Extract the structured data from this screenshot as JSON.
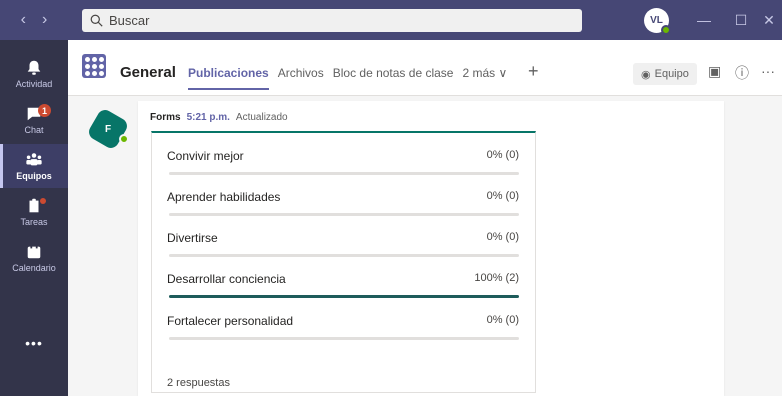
{
  "app": {
    "search_placeholder": "Buscar",
    "user_initials": "VL",
    "accent": "#6264a7",
    "titlebar_color": "#464775"
  },
  "rail": {
    "items": [
      {
        "label": "Actividad",
        "icon": "bell-icon"
      },
      {
        "label": "Chat",
        "icon": "chat-icon",
        "badge": "1"
      },
      {
        "label": "Equipos",
        "icon": "teams-icon",
        "active": true
      },
      {
        "label": "Tareas",
        "icon": "assignments-icon"
      },
      {
        "label": "Calendario",
        "icon": "calendar-icon"
      }
    ],
    "more": "•••"
  },
  "header": {
    "channel": "General",
    "tabs": [
      "Publicaciones",
      "Archivos",
      "Bloc de notas de clase",
      "2 más ∨"
    ],
    "team_button": "Equipo"
  },
  "post": {
    "sender": "Forms",
    "time": "5:21 p.m.",
    "status": "Actualizado",
    "options": [
      {
        "label": "Convivir mejor",
        "value": "0% (0)",
        "percent": 0
      },
      {
        "label": "Aprender habilidades",
        "value": "0% (0)",
        "percent": 0
      },
      {
        "label": "Divertirse",
        "value": "0% (0)",
        "percent": 0
      },
      {
        "label": "Desarrollar conciencia",
        "value": "100% (2)",
        "percent": 100
      },
      {
        "label": "Fortalecer personalidad",
        "value": "0% (0)",
        "percent": 0
      }
    ],
    "responses": "2 respuestas"
  }
}
